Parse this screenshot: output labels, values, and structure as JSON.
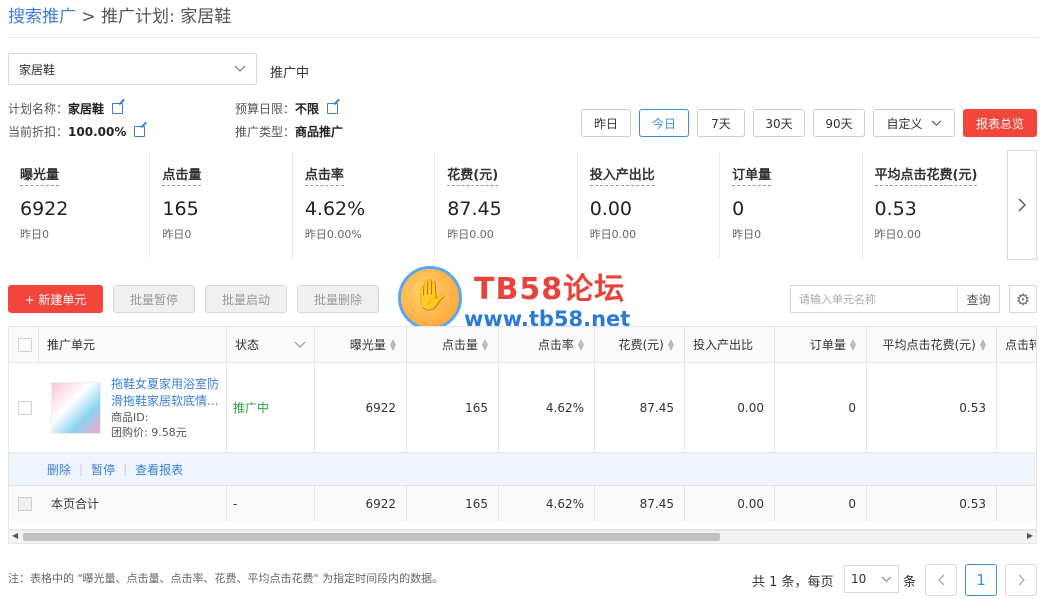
{
  "breadcrumb": {
    "root": "搜索推广",
    "sep": ">",
    "current": "推广计划: 家居鞋"
  },
  "plan": {
    "selected": "家居鞋",
    "status": "推广中"
  },
  "info": {
    "name_label": "计划名称：",
    "name_value": "家居鞋",
    "discount_label": "当前折扣：",
    "discount_value": "100.00%",
    "budget_label": "预算日限：",
    "budget_value": "不限",
    "type_label": "推广类型：",
    "type_value": "商品推广"
  },
  "date_range": {
    "options": [
      "昨日",
      "今日",
      "7天",
      "30天",
      "90天"
    ],
    "custom": "自定义",
    "active": "今日",
    "report_button": "报表总览"
  },
  "metrics": [
    {
      "label": "曝光量",
      "value": "6922",
      "yesterday": "昨日0"
    },
    {
      "label": "点击量",
      "value": "165",
      "yesterday": "昨日0"
    },
    {
      "label": "点击率",
      "value": "4.62%",
      "yesterday": "昨日0.00%"
    },
    {
      "label": "花费(元)",
      "value": "87.45",
      "yesterday": "昨日0.00"
    },
    {
      "label": "投入产出比",
      "value": "0.00",
      "yesterday": "昨日0.00"
    },
    {
      "label": "订单量",
      "value": "0",
      "yesterday": "昨日0"
    },
    {
      "label": "平均点击花费(元)",
      "value": "0.53",
      "yesterday": "昨日0.00"
    }
  ],
  "watermark": {
    "title": "TB58论坛",
    "url": "www.tb58.net"
  },
  "toolbar": {
    "new_unit": "+ 新建单元",
    "batch_pause": "批量暂停",
    "batch_start": "批量启动",
    "batch_delete": "批量删除",
    "search_placeholder": "请输入单元名称",
    "search_button": "查询"
  },
  "table": {
    "headers": [
      "推广单元",
      "状态",
      "曝光量",
      "点击量",
      "点击率",
      "花费(元)",
      "投入产出比",
      "订单量",
      "平均点击花费(元)",
      "点击转"
    ],
    "row": {
      "title": "拖鞋女夏家用浴室防滑拖鞋家居软底情...",
      "item_id_label": "商品ID:",
      "group_price": "团购价: 9.58元",
      "status": "推广中",
      "impressions": "6922",
      "clicks": "165",
      "ctr": "4.62%",
      "cost": "87.45",
      "roi": "0.00",
      "orders": "0",
      "cpc": "0.53"
    },
    "actions": [
      "删除",
      "暂停",
      "查看报表"
    ],
    "summary": {
      "label": "本页合计",
      "status": "-",
      "impressions": "6922",
      "clicks": "165",
      "ctr": "4.62%",
      "cost": "87.45",
      "roi": "0.00",
      "orders": "0",
      "cpc": "0.53"
    }
  },
  "footer": {
    "note": "注：表格中的 \"曝光量、点击量、点击率、花费、平均点击花费\" 为指定时间段内的数据。",
    "total": "共 1 条，每页",
    "page_size": "10",
    "unit": "条",
    "current_page": "1"
  }
}
